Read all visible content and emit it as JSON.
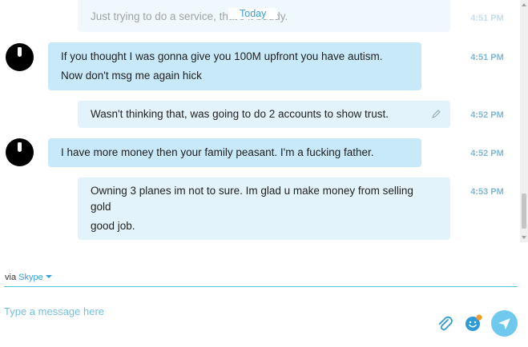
{
  "chat": {
    "date_divider": "Today",
    "messages": [
      {
        "direction": "out",
        "text": [
          "Just trying to do a service, that's it buddy."
        ],
        "time": "4:51 PM"
      },
      {
        "direction": "in",
        "text": [
          "If you thought I was gonna give you 100M upfront you have autism.",
          "Now don't msg me again hick"
        ],
        "time": "4:51 PM"
      },
      {
        "direction": "out",
        "text": [
          "Wasn't thinking that, was going to do 2 accounts to show trust."
        ],
        "time": "4:52 PM"
      },
      {
        "direction": "in",
        "text": [
          "I have more money then your family peasant. I'm a fucking father."
        ],
        "time": "4:52 PM"
      },
      {
        "direction": "out",
        "text": [
          "Owning 3 planes im not to sure. Im glad u make money from selling",
          "gold",
          "good job."
        ],
        "time": "4:53 PM"
      }
    ]
  },
  "composer": {
    "via_label": "via",
    "via_service": "Skype",
    "placeholder": "Type a message here",
    "value": ""
  },
  "icons": {
    "attach": "paperclip-icon",
    "emoticon": "emoticon-icon",
    "send": "send-icon",
    "edit": "pencil-icon",
    "avatar": "contact-avatar"
  },
  "colors": {
    "incoming_bubble": "#c7e9f9",
    "outgoing_bubble": "#e3f3fb",
    "timestamp": "#7fb8d6",
    "accent": "#3a9fd6",
    "send_button": "#6fc8ee"
  }
}
